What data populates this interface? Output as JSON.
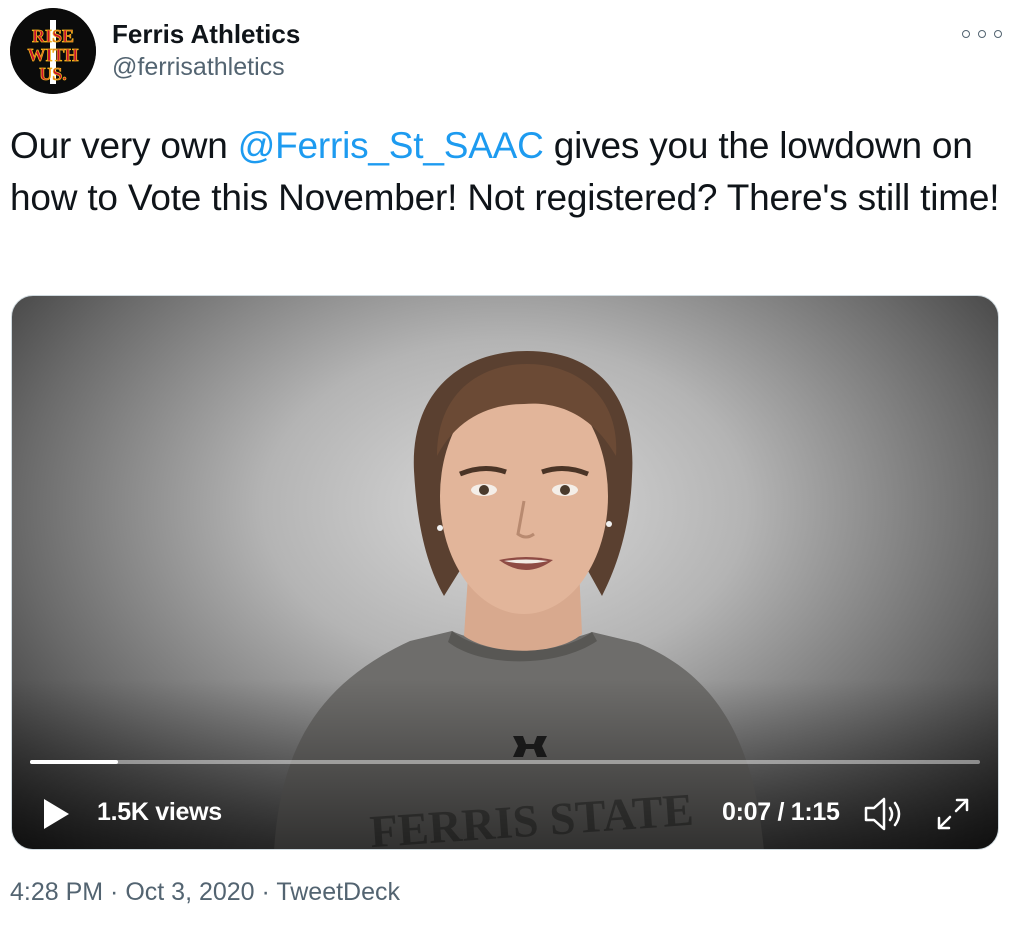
{
  "author": {
    "name": "Ferris Athletics",
    "handle": "@ferrisathletics",
    "avatar_text": [
      "RISE",
      "WITH",
      "US."
    ]
  },
  "tweet": {
    "text_before": "Our very own ",
    "mention": "@Ferris_St_SAAC",
    "text_after": " gives you the lowdown on how to Vote this November! Not registered? There's still time!"
  },
  "video": {
    "views": "1.5K views",
    "time": "0:07 / 1:15",
    "progress_fraction": 0.093,
    "shirt_text": "FERRIS STATE"
  },
  "meta": {
    "time": "4:28 PM",
    "separator": " · ",
    "date": "Oct 3, 2020",
    "source": "TweetDeck"
  },
  "colors": {
    "link": "#1d9bf0",
    "secondary_text": "#536471",
    "brand_red": "#c8102e",
    "brand_gold": "#f2b51c"
  },
  "icons": [
    "more-icon",
    "play-icon",
    "volume-icon",
    "fullscreen-icon"
  ]
}
